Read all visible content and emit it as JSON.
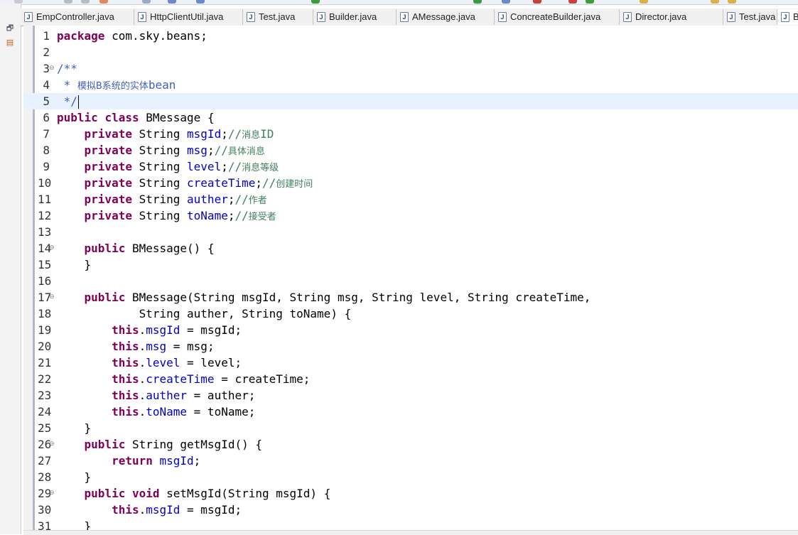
{
  "tabs": [
    {
      "label": "EmpController.java",
      "active": false
    },
    {
      "label": "HttpClientUtil.java",
      "active": false
    },
    {
      "label": "Test.java",
      "active": false
    },
    {
      "label": "Builder.java",
      "active": false
    },
    {
      "label": "AMessage.java",
      "active": false
    },
    {
      "label": "ConcreateBuilder.java",
      "active": false
    },
    {
      "label": "Director.java",
      "active": false
    },
    {
      "label": "Test.java",
      "active": false
    },
    {
      "label": "B",
      "active": true
    }
  ],
  "editor": {
    "current_line": 5,
    "lines": [
      {
        "n": "1",
        "fold": false,
        "tokens": [
          [
            "kw",
            "package"
          ],
          [
            "n",
            " com.sky.beans;"
          ]
        ]
      },
      {
        "n": "2",
        "fold": false,
        "tokens": []
      },
      {
        "n": "3",
        "fold": true,
        "tokens": [
          [
            "doc",
            "/**"
          ]
        ]
      },
      {
        "n": "4",
        "fold": false,
        "tokens": [
          [
            "doc",
            " * "
          ],
          [
            "doccjk",
            "模拟B系统的实体"
          ],
          [
            "doc",
            "bean"
          ]
        ]
      },
      {
        "n": "5",
        "fold": false,
        "tokens": [
          [
            "doc",
            " */"
          ]
        ]
      },
      {
        "n": "6",
        "fold": false,
        "tokens": [
          [
            "kw",
            "public"
          ],
          [
            "n",
            " "
          ],
          [
            "kw",
            "class"
          ],
          [
            "n",
            " BMessage {"
          ]
        ]
      },
      {
        "n": "7",
        "fold": false,
        "tokens": [
          [
            "n",
            "    "
          ],
          [
            "kw",
            "private"
          ],
          [
            "n",
            " String "
          ],
          [
            "fld",
            "msgId"
          ],
          [
            "n",
            ";"
          ],
          [
            "cmt",
            "//"
          ],
          [
            "cmtcjk",
            "消息"
          ],
          [
            "cmt",
            "ID"
          ]
        ]
      },
      {
        "n": "8",
        "fold": false,
        "tokens": [
          [
            "n",
            "    "
          ],
          [
            "kw",
            "private"
          ],
          [
            "n",
            " String "
          ],
          [
            "fld",
            "msg"
          ],
          [
            "n",
            ";"
          ],
          [
            "cmt",
            "//"
          ],
          [
            "cmtcjk",
            "具体消息"
          ]
        ]
      },
      {
        "n": "9",
        "fold": false,
        "tokens": [
          [
            "n",
            "    "
          ],
          [
            "kw",
            "private"
          ],
          [
            "n",
            " String "
          ],
          [
            "fld",
            "level"
          ],
          [
            "n",
            ";"
          ],
          [
            "cmt",
            "//"
          ],
          [
            "cmtcjk",
            "消息等级"
          ]
        ]
      },
      {
        "n": "10",
        "fold": false,
        "tokens": [
          [
            "n",
            "    "
          ],
          [
            "kw",
            "private"
          ],
          [
            "n",
            " String "
          ],
          [
            "fld",
            "createTime"
          ],
          [
            "n",
            ";"
          ],
          [
            "cmt",
            "//"
          ],
          [
            "cmtcjk",
            "创建时间"
          ]
        ]
      },
      {
        "n": "11",
        "fold": false,
        "tokens": [
          [
            "n",
            "    "
          ],
          [
            "kw",
            "private"
          ],
          [
            "n",
            " String "
          ],
          [
            "fld",
            "auther"
          ],
          [
            "n",
            ";"
          ],
          [
            "cmt",
            "//"
          ],
          [
            "cmtcjk",
            "作者"
          ]
        ]
      },
      {
        "n": "12",
        "fold": false,
        "tokens": [
          [
            "n",
            "    "
          ],
          [
            "kw",
            "private"
          ],
          [
            "n",
            " String "
          ],
          [
            "fld",
            "toName"
          ],
          [
            "n",
            ";"
          ],
          [
            "cmt",
            "//"
          ],
          [
            "cmtcjk",
            "接受者"
          ]
        ]
      },
      {
        "n": "13",
        "fold": false,
        "tokens": []
      },
      {
        "n": "14",
        "fold": true,
        "tokens": [
          [
            "n",
            "    "
          ],
          [
            "kw",
            "public"
          ],
          [
            "n",
            " BMessage() {"
          ]
        ]
      },
      {
        "n": "15",
        "fold": false,
        "tokens": [
          [
            "n",
            "    }"
          ]
        ]
      },
      {
        "n": "16",
        "fold": false,
        "tokens": []
      },
      {
        "n": "17",
        "fold": true,
        "tokens": [
          [
            "n",
            "    "
          ],
          [
            "kw",
            "public"
          ],
          [
            "n",
            " BMessage(String msgId, String msg, String level, String createTime,"
          ]
        ]
      },
      {
        "n": "18",
        "fold": false,
        "tokens": [
          [
            "n",
            "            String auther, String toName) {"
          ]
        ]
      },
      {
        "n": "19",
        "fold": false,
        "tokens": [
          [
            "n",
            "        "
          ],
          [
            "kw",
            "this"
          ],
          [
            "n",
            "."
          ],
          [
            "fld",
            "msgId"
          ],
          [
            "n",
            " = msgId;"
          ]
        ]
      },
      {
        "n": "20",
        "fold": false,
        "tokens": [
          [
            "n",
            "        "
          ],
          [
            "kw",
            "this"
          ],
          [
            "n",
            "."
          ],
          [
            "fld",
            "msg"
          ],
          [
            "n",
            " = msg;"
          ]
        ]
      },
      {
        "n": "21",
        "fold": false,
        "tokens": [
          [
            "n",
            "        "
          ],
          [
            "kw",
            "this"
          ],
          [
            "n",
            "."
          ],
          [
            "fld",
            "level"
          ],
          [
            "n",
            " = level;"
          ]
        ]
      },
      {
        "n": "22",
        "fold": false,
        "tokens": [
          [
            "n",
            "        "
          ],
          [
            "kw",
            "this"
          ],
          [
            "n",
            "."
          ],
          [
            "fld",
            "createTime"
          ],
          [
            "n",
            " = createTime;"
          ]
        ]
      },
      {
        "n": "23",
        "fold": false,
        "tokens": [
          [
            "n",
            "        "
          ],
          [
            "kw",
            "this"
          ],
          [
            "n",
            "."
          ],
          [
            "fld",
            "auther"
          ],
          [
            "n",
            " = auther;"
          ]
        ]
      },
      {
        "n": "24",
        "fold": false,
        "tokens": [
          [
            "n",
            "        "
          ],
          [
            "kw",
            "this"
          ],
          [
            "n",
            "."
          ],
          [
            "fld",
            "toName"
          ],
          [
            "n",
            " = toName;"
          ]
        ]
      },
      {
        "n": "25",
        "fold": false,
        "tokens": [
          [
            "n",
            "    }"
          ]
        ]
      },
      {
        "n": "26",
        "fold": true,
        "tokens": [
          [
            "n",
            "    "
          ],
          [
            "kw",
            "public"
          ],
          [
            "n",
            " String getMsgId() {"
          ]
        ]
      },
      {
        "n": "27",
        "fold": false,
        "tokens": [
          [
            "n",
            "        "
          ],
          [
            "kw",
            "return"
          ],
          [
            "n",
            " "
          ],
          [
            "fld",
            "msgId"
          ],
          [
            "n",
            ";"
          ]
        ]
      },
      {
        "n": "28",
        "fold": false,
        "tokens": [
          [
            "n",
            "    }"
          ]
        ]
      },
      {
        "n": "29",
        "fold": true,
        "tokens": [
          [
            "n",
            "    "
          ],
          [
            "kw",
            "public"
          ],
          [
            "n",
            " "
          ],
          [
            "kw",
            "void"
          ],
          [
            "n",
            " setMsgId(String msgId) {"
          ]
        ]
      },
      {
        "n": "30",
        "fold": false,
        "tokens": [
          [
            "n",
            "        "
          ],
          [
            "kw",
            "this"
          ],
          [
            "n",
            "."
          ],
          [
            "fld",
            "msgId"
          ],
          [
            "n",
            " = msgId;"
          ]
        ]
      },
      {
        "n": "31",
        "fold": false,
        "tokens": [
          [
            "n",
            "    }"
          ]
        ]
      }
    ]
  },
  "colors": {
    "keyword": "#7f0055",
    "field": "#0000c0",
    "comment": "#3f7f5f",
    "javadoc": "#3f5fbf",
    "current_line": "#e8f2fe"
  },
  "icons": {
    "tab": "java-file-icon",
    "trim": [
      "restore-icon",
      "outline-icon"
    ]
  }
}
